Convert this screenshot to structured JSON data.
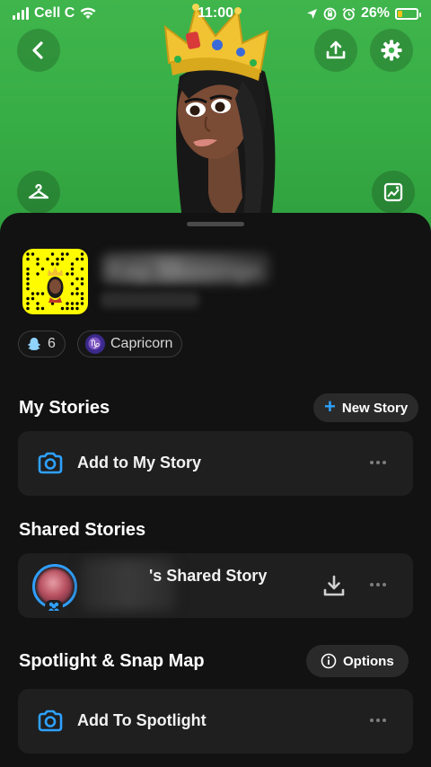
{
  "status_bar": {
    "carrier": "Cell C",
    "time": "11:00",
    "battery_percent": "26%",
    "battery_level": 0.26,
    "battery_color": "#f3c01a"
  },
  "header": {
    "background_color": "#3fb54c",
    "back_icon": "chevron-left-icon",
    "share_icon": "upload-icon",
    "settings_icon": "gear-icon",
    "wardrobe_icon": "hanger-icon",
    "background_picker_icon": "image-icon"
  },
  "profile": {
    "display_name": "Kay Nkosinge",
    "chips": [
      {
        "icon": "ghost-icon",
        "label": "6"
      },
      {
        "icon": "capricorn-icon",
        "label": "Capricorn"
      }
    ]
  },
  "my_stories": {
    "title": "My Stories",
    "new_story_label": "New Story",
    "add_label": "Add to My Story"
  },
  "shared_stories": {
    "title": "Shared Stories",
    "story_label": "'s Shared Story"
  },
  "spotlight": {
    "title": "Spotlight & Snap Map",
    "options_label": "Options",
    "add_label": "Add To Spotlight"
  },
  "colors": {
    "accent": "#2ea1ff",
    "sheet": "#121212",
    "card": "#1f1f1f",
    "snapcode": "#fffc00"
  }
}
